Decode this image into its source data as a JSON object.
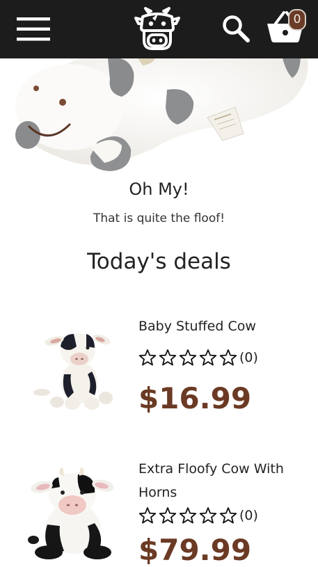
{
  "header": {
    "menu_icon": "hamburger-menu-icon",
    "logo_icon": "cow-head-logo-icon",
    "search_icon": "search-icon",
    "cart_icon": "basket-icon",
    "cart_count": "0",
    "bar_color": "#1c1c1c",
    "badge_color": "#6a3b26"
  },
  "hero": {
    "image_icon": "plush-cow-lying-image",
    "title": "Oh My!",
    "subtitle": "That is quite the floof!"
  },
  "deals": {
    "heading": "Today's deals",
    "products": [
      {
        "name": "Baby Stuffed Cow",
        "rating_count": "(0)",
        "stars_filled": 0,
        "stars_total": 5,
        "price": "$16.99",
        "image_icon": "baby-stuffed-cow-image"
      },
      {
        "name": "Extra Floofy Cow With Horns",
        "rating_count": "(0)",
        "stars_filled": 0,
        "stars_total": 5,
        "price": "$79.99",
        "image_icon": "floofy-cow-with-horns-image"
      }
    ],
    "price_color": "#6b3a24"
  }
}
